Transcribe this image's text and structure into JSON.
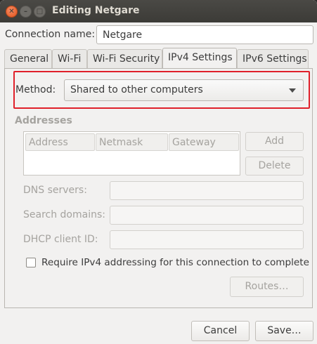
{
  "window": {
    "title": "Editing Netgare"
  },
  "connection": {
    "name_label": "Connection name:",
    "name_value": "Netgare"
  },
  "tabs": [
    {
      "label": "General"
    },
    {
      "label": "Wi-Fi"
    },
    {
      "label": "Wi-Fi Security"
    },
    {
      "label": "IPv4 Settings"
    },
    {
      "label": "IPv6 Settings"
    }
  ],
  "ipv4": {
    "method_label": "Method:",
    "method_value": "Shared to other computers",
    "addresses_heading": "Addresses",
    "columns": [
      "Address",
      "Netmask",
      "Gateway"
    ],
    "add_label": "Add",
    "delete_label": "Delete",
    "dns_label": "DNS servers:",
    "search_label": "Search domains:",
    "dhcp_label": "DHCP client ID:",
    "require_label": "Require IPv4 addressing for this connection to complete",
    "routes_label": "Routes…"
  },
  "footer": {
    "cancel_label": "Cancel",
    "save_label": "Save…"
  },
  "colors": {
    "highlight": "#e0202a",
    "titlebar": "#3c3b37",
    "close": "#e2551d"
  }
}
